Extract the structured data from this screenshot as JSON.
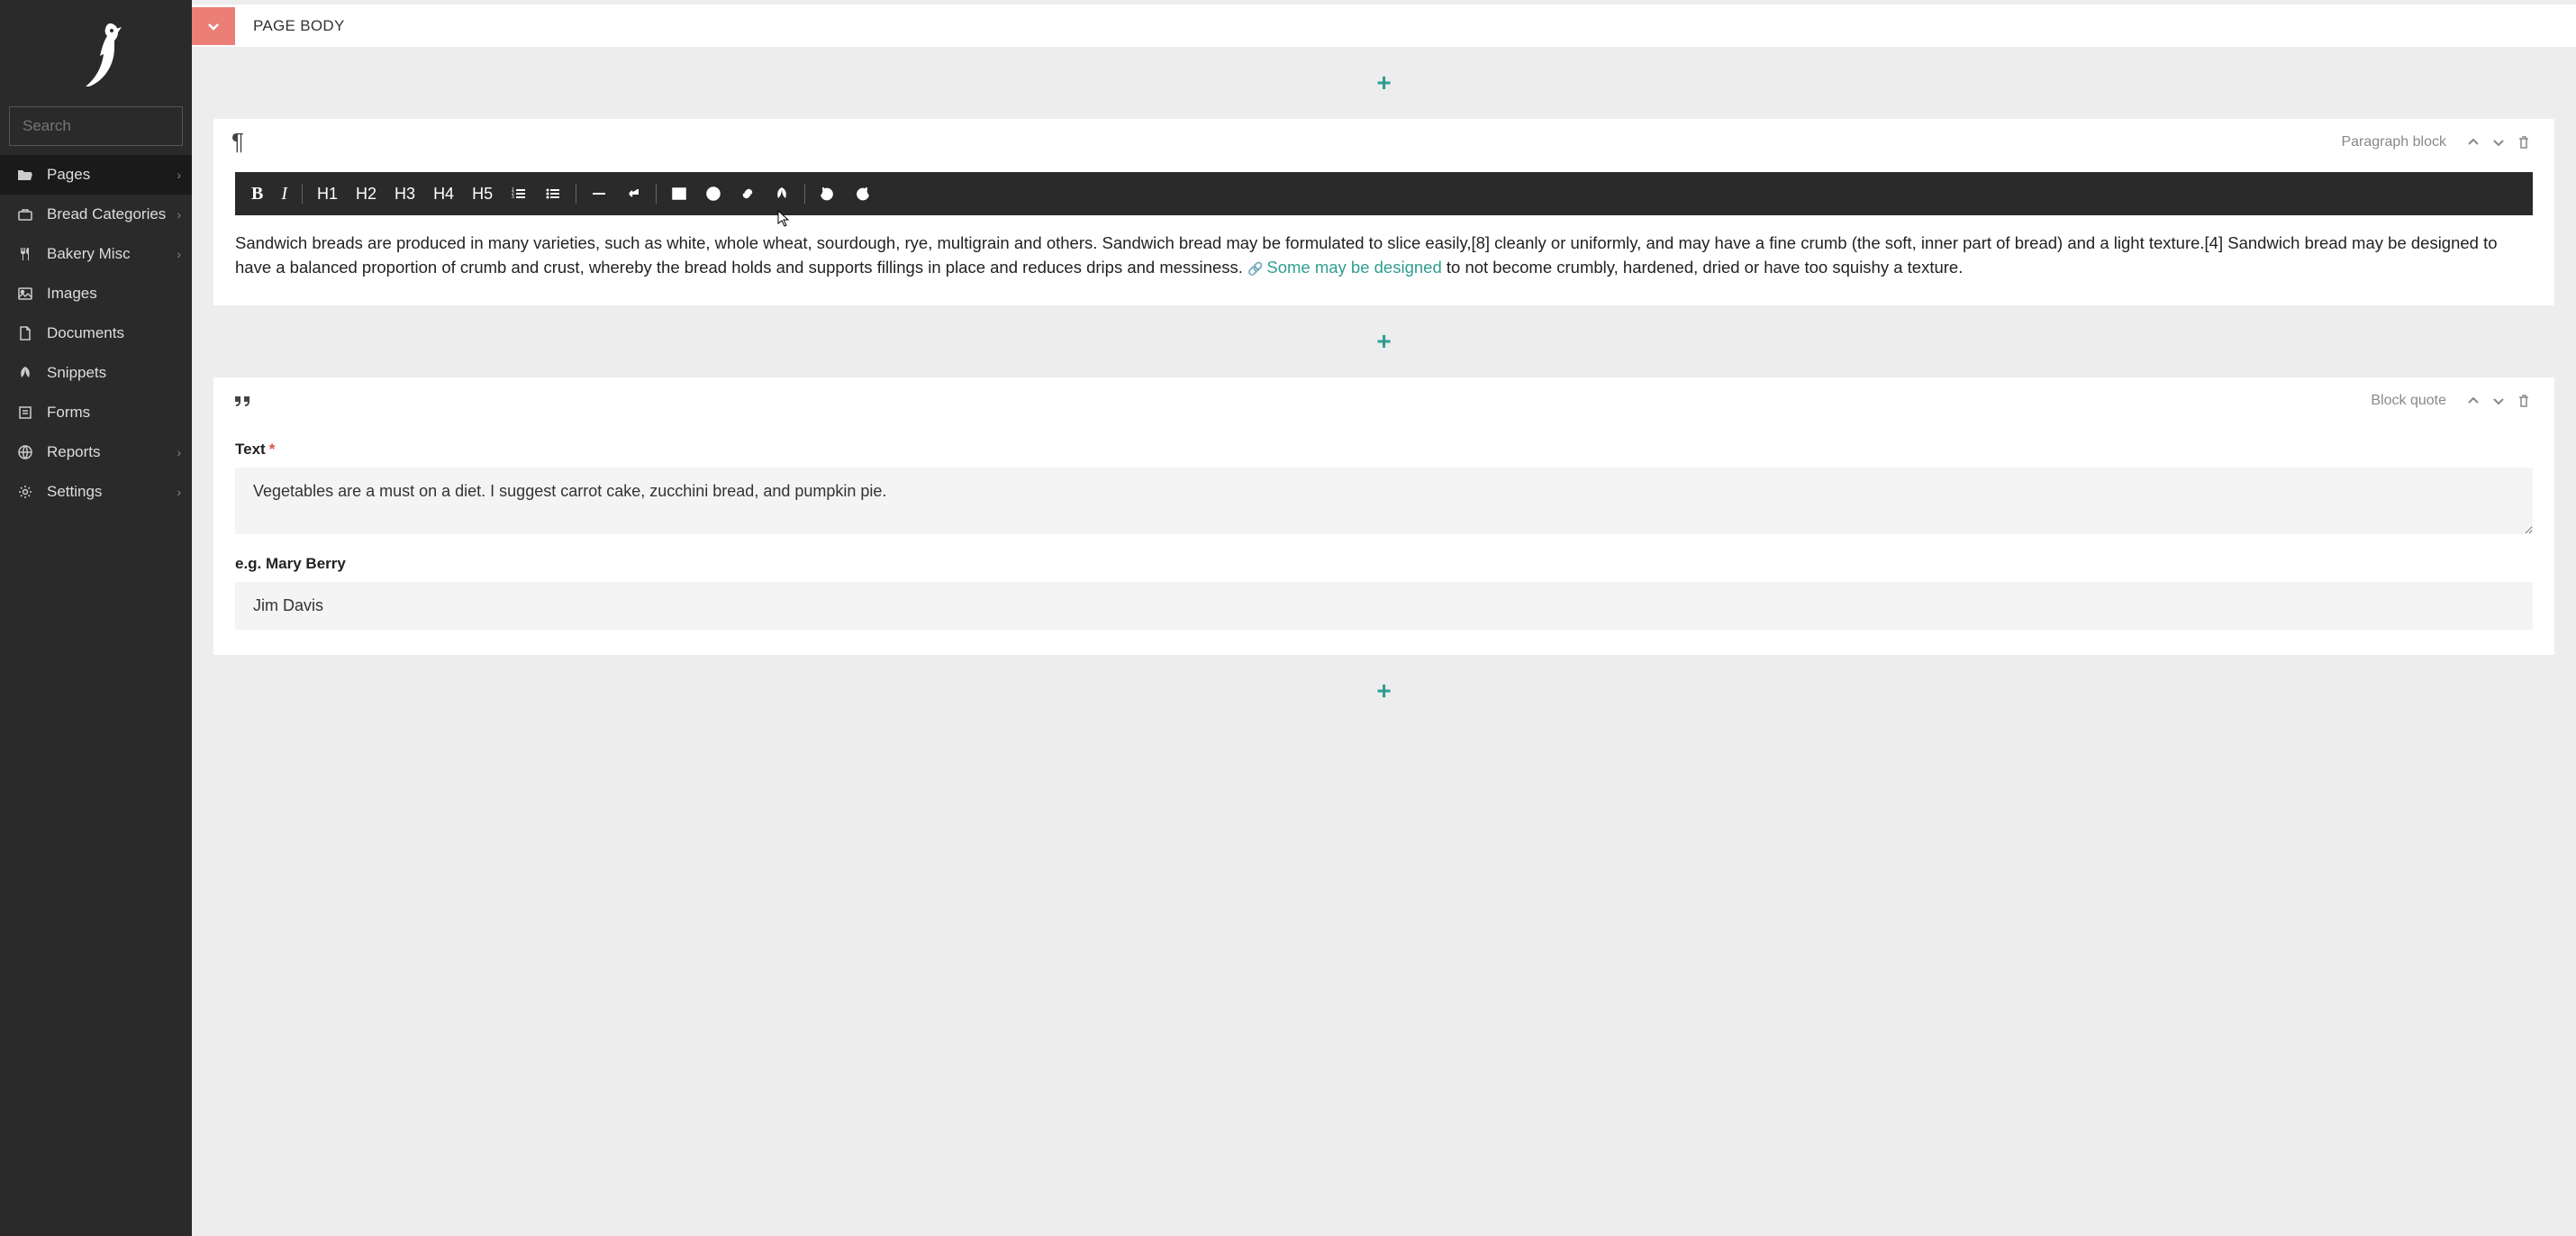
{
  "sidebar": {
    "search_placeholder": "Search",
    "items": [
      {
        "label": "Pages",
        "icon": "folder-open",
        "has_sub": true,
        "active": true
      },
      {
        "label": "Bread Categories",
        "icon": "briefcase",
        "has_sub": true
      },
      {
        "label": "Bakery Misc",
        "icon": "utensils",
        "has_sub": true
      },
      {
        "label": "Images",
        "icon": "image",
        "has_sub": false
      },
      {
        "label": "Documents",
        "icon": "file",
        "has_sub": false
      },
      {
        "label": "Snippets",
        "icon": "leaf",
        "has_sub": false
      },
      {
        "label": "Forms",
        "icon": "form",
        "has_sub": false
      },
      {
        "label": "Reports",
        "icon": "globe",
        "has_sub": true
      },
      {
        "label": "Settings",
        "icon": "gear",
        "has_sub": true
      }
    ]
  },
  "header": {
    "title": "PAGE BODY"
  },
  "paragraph_block": {
    "title": "Paragraph block",
    "toolbar": {
      "h1": "H1",
      "h2": "H2",
      "h3": "H3",
      "h4": "H4",
      "h5": "H5"
    },
    "text_before_link": "Sandwich breads are produced in many varieties, such as white, whole wheat, sourdough, rye, multigrain and others. Sandwich bread may be formulated to slice easily,[8] cleanly or uniformly, and may have a fine crumb (the soft, inner part of bread) and a light texture.[4] Sandwich bread may be designed to have a balanced proportion of crumb and crust, whereby the bread holds and supports fillings in place and reduces drips and messiness. ",
    "link_text": "Some may be designed",
    "text_after_link": " to not become crumbly, hardened, dried or have too squishy a texture."
  },
  "quote_block": {
    "title": "Block quote",
    "text_label": "Text",
    "text_value": "Vegetables are a must on a diet. I suggest carrot cake, zucchini bread, and pumpkin pie.",
    "attr_label": "e.g. Mary Berry",
    "attr_value": "Jim Davis"
  }
}
